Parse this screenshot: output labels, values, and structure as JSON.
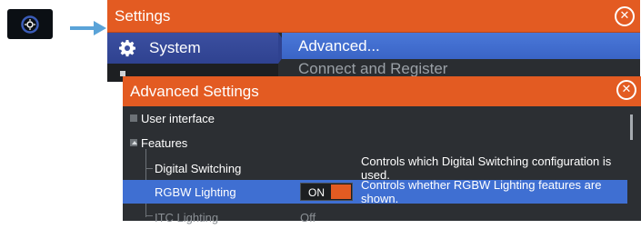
{
  "settings_window": {
    "title": "Settings",
    "sidebar": {
      "items": [
        {
          "label": "System",
          "icon": "gear-icon"
        }
      ]
    },
    "menu": [
      {
        "label": "Advanced..."
      },
      {
        "label": "Connect and Register"
      }
    ]
  },
  "advanced_window": {
    "title": "Advanced Settings",
    "rows": [
      {
        "label": "User interface",
        "expanded": false
      },
      {
        "label": "Features",
        "expanded": true
      },
      {
        "label": "Digital Switching",
        "description": "Controls which Digital Switching configuration is used."
      },
      {
        "label": "RGBW Lighting",
        "toggle": "ON",
        "description": "Controls whether RGBW Lighting features are shown."
      },
      {
        "label": "ITC Lighting",
        "value": "Off"
      }
    ]
  },
  "colors": {
    "accent": "#e35b22",
    "selection": "#3f6fd2",
    "background": "#2c2f33"
  }
}
